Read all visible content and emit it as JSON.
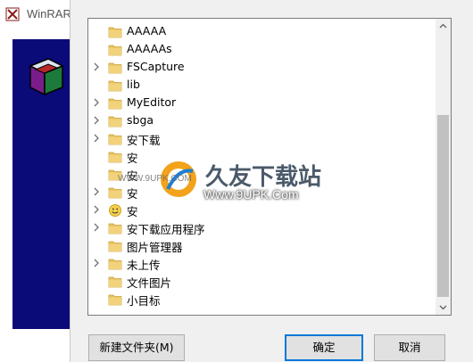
{
  "background_window": {
    "title": "WinRAR"
  },
  "folder_tree": {
    "items": [
      {
        "label": "AAAAA",
        "expandable": false,
        "icon": "folder-icon"
      },
      {
        "label": "AAAAAs",
        "expandable": false,
        "icon": "folder-icon"
      },
      {
        "label": "FSCapture",
        "expandable": true,
        "icon": "folder-icon"
      },
      {
        "label": "lib",
        "expandable": false,
        "icon": "folder-icon"
      },
      {
        "label": "MyEditor",
        "expandable": true,
        "icon": "folder-icon"
      },
      {
        "label": "sbga",
        "expandable": true,
        "icon": "folder-icon"
      },
      {
        "label": "安下载",
        "expandable": true,
        "icon": "folder-icon"
      },
      {
        "label": "安",
        "expandable": false,
        "icon": "folder-icon"
      },
      {
        "label": "安",
        "expandable": false,
        "icon": "folder-icon"
      },
      {
        "label": "安",
        "expandable": true,
        "icon": "folder-icon"
      },
      {
        "label": "安",
        "expandable": true,
        "icon": "smiley-folder-icon"
      },
      {
        "label": "安下载应用程序",
        "expandable": true,
        "icon": "folder-icon"
      },
      {
        "label": "图片管理器",
        "expandable": false,
        "icon": "folder-icon"
      },
      {
        "label": "未上传",
        "expandable": true,
        "icon": "folder-icon"
      },
      {
        "label": "文件图片",
        "expandable": false,
        "icon": "folder-icon"
      },
      {
        "label": "小目标",
        "expandable": false,
        "icon": "folder-icon"
      }
    ]
  },
  "buttons": {
    "new_folder": "新建文件夹(M)",
    "ok": "确定",
    "cancel": "取消"
  },
  "watermark": {
    "title": "久友下载站",
    "url": "Www.9UPK.Com",
    "small_url": "WWW.9UPK.COM"
  },
  "colors": {
    "folder": "#e8c15a",
    "banner": "#0a0a78",
    "accent": "#0078d7"
  }
}
